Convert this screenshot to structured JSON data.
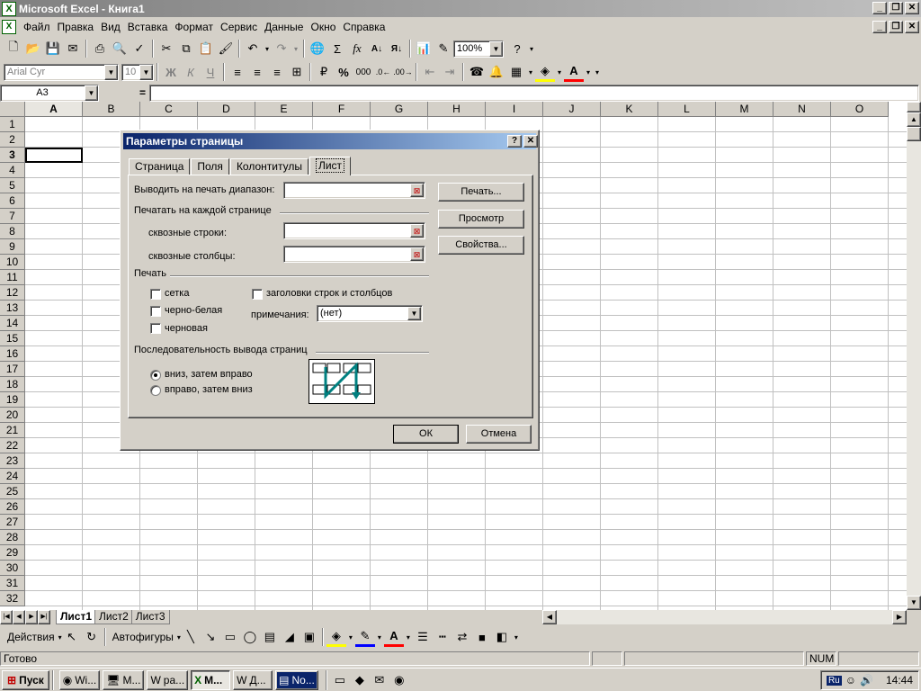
{
  "window": {
    "title": "Microsoft Excel - Книга1",
    "app_icon": "excel-icon"
  },
  "menu": [
    "Файл",
    "Правка",
    "Вид",
    "Вставка",
    "Формат",
    "Сервис",
    "Данные",
    "Окно",
    "Справка"
  ],
  "toolbar1": {
    "zoom": "100%"
  },
  "toolbar2": {
    "font_name": "Arial Cyr",
    "font_size": "10",
    "bold": "Ж",
    "italic": "К",
    "underline": "Ч",
    "thousands": "000",
    "percent": "%"
  },
  "formula": {
    "namebox": "A3",
    "equals": "="
  },
  "grid": {
    "columns": [
      "A",
      "B",
      "C",
      "D",
      "E",
      "F",
      "G",
      "H",
      "I",
      "J",
      "K",
      "L",
      "M",
      "N",
      "O"
    ],
    "rows": [
      "1",
      "2",
      "3",
      "4",
      "5",
      "6",
      "7",
      "8",
      "9",
      "10",
      "11",
      "12",
      "13",
      "14",
      "15",
      "16",
      "17",
      "18",
      "19",
      "20",
      "21",
      "22",
      "23",
      "24",
      "25",
      "26",
      "27",
      "28",
      "29",
      "30",
      "31",
      "32"
    ]
  },
  "sheets": [
    "Лист1",
    "Лист2",
    "Лист3"
  ],
  "drawbar": {
    "actions": "Действия",
    "autoshapes": "Автофигуры"
  },
  "status": {
    "ready": "Готово",
    "num": "NUM"
  },
  "taskbar": {
    "start": "Пуск",
    "buttons": [
      "Wi...",
      "М...",
      "ра...",
      "М...",
      "Д...",
      "No..."
    ],
    "clock": "14:44",
    "lang": "Ru"
  },
  "dialog": {
    "title": "Параметры страницы",
    "help": "?",
    "tabs": [
      "Страница",
      "Поля",
      "Колонтитулы",
      "Лист"
    ],
    "print_area_label": "Выводить на печать диапазон:",
    "print_titles_group": "Печатать на каждой странице",
    "rows_label": "сквозные строки:",
    "cols_label": "сквозные столбцы:",
    "print_group": "Печать",
    "gridlines": "сетка",
    "bw": "черно-белая",
    "draft": "черновая",
    "headings": "заголовки строк и столбцов",
    "comments_label": "примечания:",
    "comments_value": "(нет)",
    "order_group": "Последовательность вывода страниц",
    "down_then_over": "вниз, затем вправо",
    "over_then_down": "вправо, затем вниз",
    "btn_print": "Печать...",
    "btn_preview": "Просмотр",
    "btn_props": "Свойства...",
    "btn_ok": "ОК",
    "btn_cancel": "Отмена"
  }
}
